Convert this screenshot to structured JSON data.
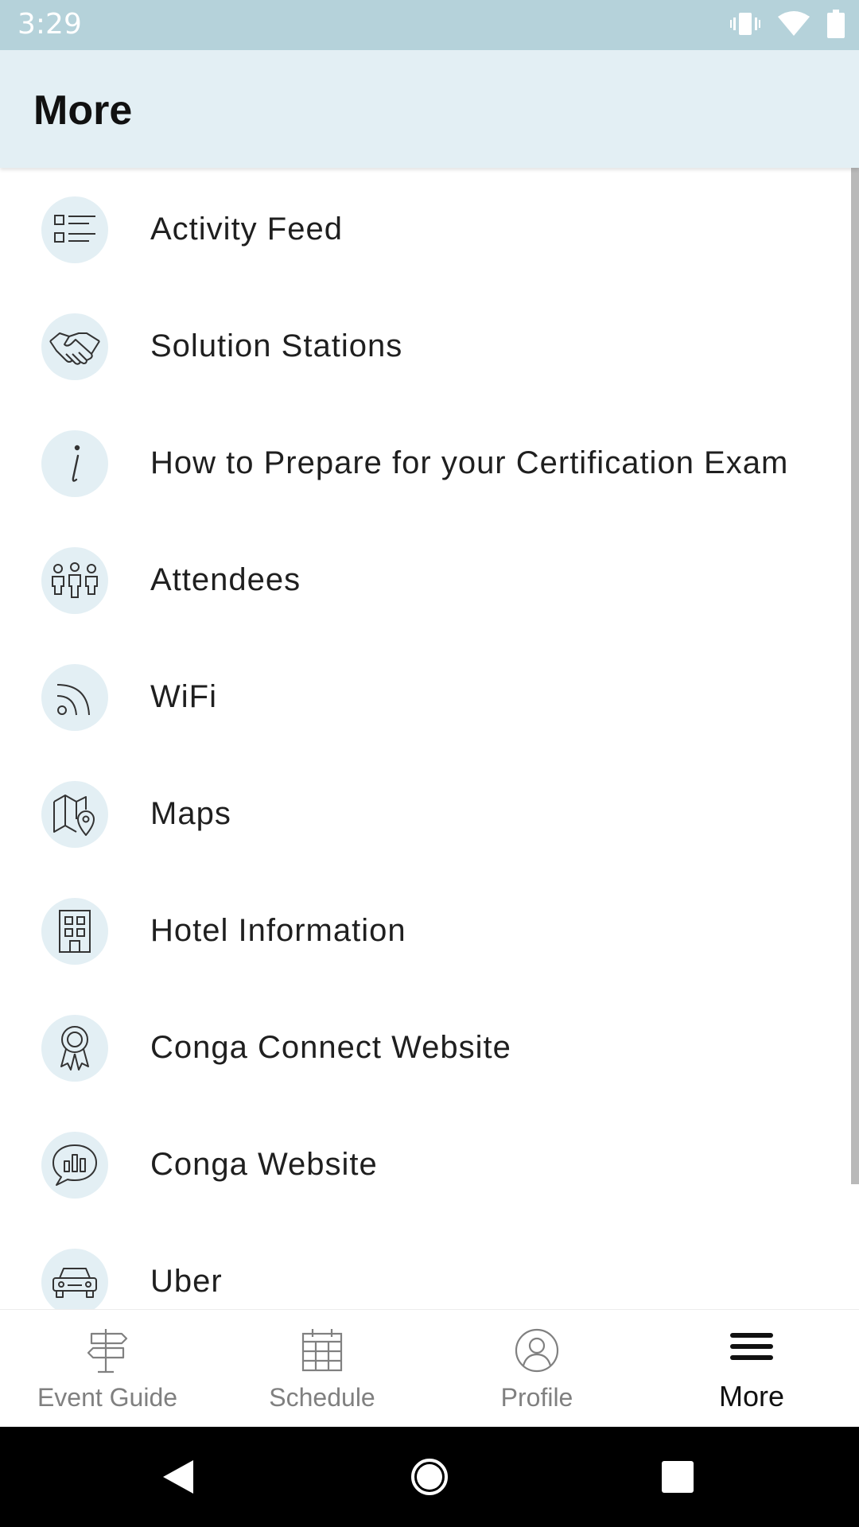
{
  "status_bar": {
    "time": "3:29",
    "icons": [
      "vibrate-icon",
      "wifi-icon",
      "battery-icon"
    ]
  },
  "app_bar": {
    "title": "More"
  },
  "menu": {
    "items": [
      {
        "label": "Activity Feed",
        "icon": "list-icon"
      },
      {
        "label": "Solution Stations",
        "icon": "handshake-icon"
      },
      {
        "label": "How to Prepare for your Certification Exam",
        "icon": "info-icon"
      },
      {
        "label": "Attendees",
        "icon": "people-icon"
      },
      {
        "label": "WiFi",
        "icon": "wifi-signal-icon"
      },
      {
        "label": "Maps",
        "icon": "map-pin-icon"
      },
      {
        "label": "Hotel Information",
        "icon": "building-icon"
      },
      {
        "label": "Conga Connect Website",
        "icon": "award-ribbon-icon"
      },
      {
        "label": "Conga Website",
        "icon": "chat-chart-icon"
      },
      {
        "label": "Uber",
        "icon": "car-icon"
      }
    ]
  },
  "bottom_nav": {
    "tabs": [
      {
        "label": "Event Guide",
        "icon": "signpost-icon",
        "active": false
      },
      {
        "label": "Schedule",
        "icon": "calendar-icon",
        "active": false
      },
      {
        "label": "Profile",
        "icon": "user-icon",
        "active": false
      },
      {
        "label": "More",
        "icon": "hamburger-menu-icon",
        "active": true
      }
    ]
  },
  "system_nav": {
    "buttons": [
      "back-icon",
      "home-icon",
      "recents-icon"
    ]
  },
  "colors": {
    "status_bar": "#b5d2da",
    "app_bar": "#e3eff4",
    "icon_circle": "#e3eff4",
    "inactive_tab": "#808080",
    "active_tab": "#111111"
  }
}
